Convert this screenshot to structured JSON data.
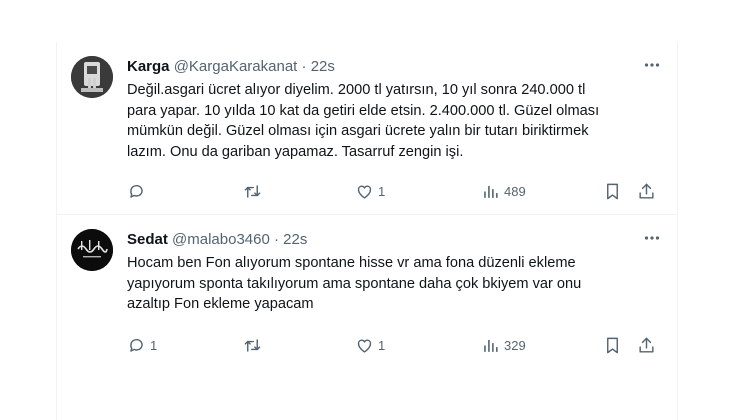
{
  "tweets": [
    {
      "name": "Karga",
      "handle": "@KargaKarakanat",
      "separator": "·",
      "time": "22s",
      "text_lines": [
        "Değil.asgari ücret alıyor diyelim. 2000 tl yatırsın, 10 yıl sonra 240.000 tl",
        "para yapar. 10 yılda 10 kat da getiri elde etsin. 2.400.000 tl. Güzel olması",
        "mümkün değil. Güzel olması için asgari ücrete yalın bir tutarı biriktirmek",
        "lazım. Onu da gariban yapamaz. Tasarruf zengin işi."
      ],
      "reply_count": "",
      "retweet_count": "",
      "like_count": "1",
      "view_count": "489"
    },
    {
      "name": "Sedat",
      "handle": "@malabo3460",
      "separator": "·",
      "time": "22s",
      "text_lines": [
        "Hocam ben Fon alıyorum spontane hisse vr ama fona düzenli ekleme",
        "yapıyorum sponta takılıyorum ama spontane daha çok bkiyem var onu",
        "azaltıp Fon ekleme yapacam"
      ],
      "reply_count": "1",
      "retweet_count": "",
      "like_count": "1",
      "view_count": "329"
    }
  ],
  "icons": {
    "reply": "reply-icon",
    "retweet": "retweet-icon",
    "like": "like-icon",
    "views": "views-icon",
    "bookmark": "bookmark-icon",
    "share": "share-icon",
    "more": "more-icon"
  },
  "colors": {
    "text": "#0f1419",
    "secondary": "#536471",
    "divider": "#eff3f4"
  }
}
